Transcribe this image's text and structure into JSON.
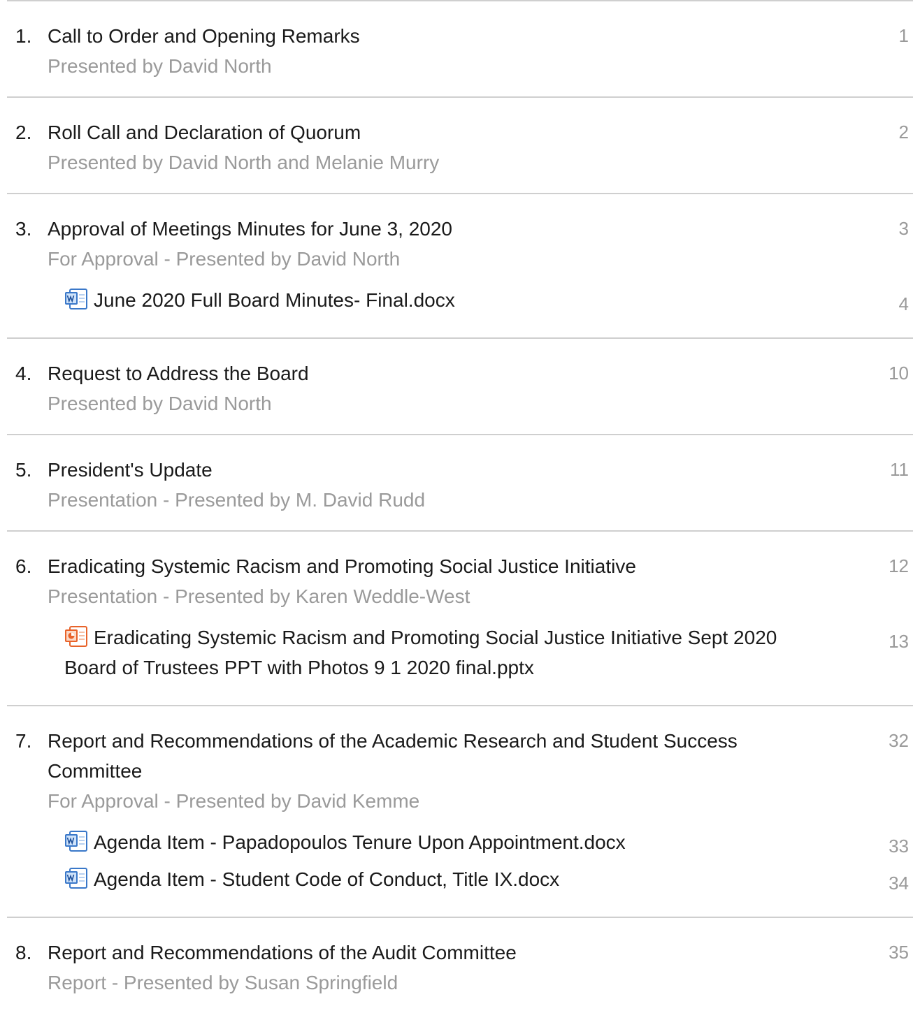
{
  "agenda": {
    "items": [
      {
        "number": "1.",
        "title": "Call to Order and Opening Remarks",
        "subtitle": "Presented by David North",
        "page": "1",
        "attachments": []
      },
      {
        "number": "2.",
        "title": "Roll Call and Declaration of Quorum",
        "subtitle": "Presented by David North and Melanie Murry",
        "page": "2",
        "attachments": []
      },
      {
        "number": "3.",
        "title": "Approval of Meetings Minutes for June 3, 2020",
        "subtitle": "For Approval - Presented by David North",
        "page": "3",
        "attachments": [
          {
            "icon": "word-document-icon",
            "name": "June 2020 Full Board Minutes- Final.docx",
            "page": "4"
          }
        ]
      },
      {
        "number": "4.",
        "title": "Request to Address the Board",
        "subtitle": "Presented by David North",
        "page": "10",
        "attachments": []
      },
      {
        "number": "5.",
        "title": "President's Update",
        "subtitle": "Presentation - Presented by M. David Rudd",
        "page": "11",
        "attachments": []
      },
      {
        "number": "6.",
        "title": "Eradicating Systemic Racism and Promoting Social Justice Initiative",
        "subtitle": "Presentation - Presented by Karen Weddle-West",
        "page": "12",
        "attachments": [
          {
            "icon": "powerpoint-document-icon",
            "name": "Eradicating Systemic Racism and Promoting Social Justice Initiative Sept 2020 Board of Trustees PPT with Photos 9 1 2020 final.pptx",
            "page": "13"
          }
        ]
      },
      {
        "number": "7.",
        "title": "Report and Recommendations of the Academic Research and Student Success Committee",
        "subtitle": "For Approval - Presented by David Kemme",
        "page": "32",
        "attachments": [
          {
            "icon": "word-document-icon",
            "name": "Agenda Item - Papadopoulos Tenure Upon Appointment.docx",
            "page": "33"
          },
          {
            "icon": "word-document-icon",
            "name": "Agenda Item - Student Code of Conduct, Title IX.docx",
            "page": "34"
          }
        ]
      },
      {
        "number": "8.",
        "title": "Report and Recommendations of the Audit Committee",
        "subtitle": "Report - Presented by Susan Springfield",
        "page": "35",
        "attachments": []
      }
    ]
  },
  "colors": {
    "divider": "#cfcfcf",
    "muted_text": "#9a9a9a",
    "body_text": "#1a1a1a",
    "word_icon_blue": "#2b6cc4",
    "ppt_icon_orange": "#e8632a"
  }
}
